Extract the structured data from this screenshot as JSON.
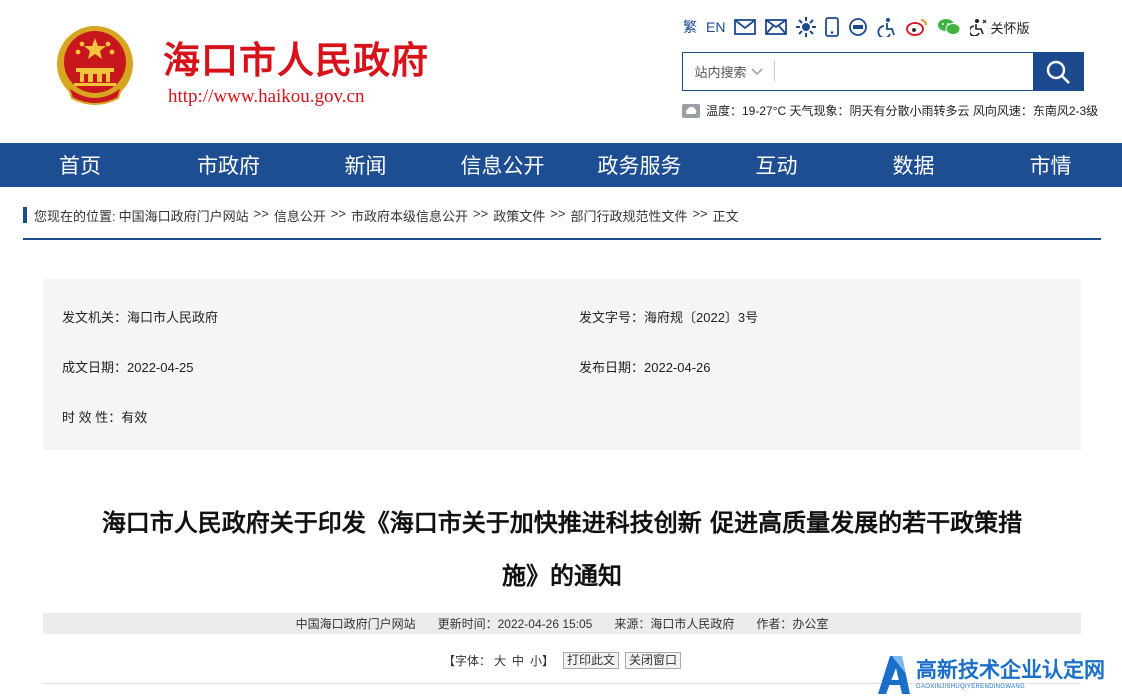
{
  "header": {
    "site_name": "海口市人民政府",
    "site_url": "http://www.haikou.gov.cn",
    "tools": {
      "traditional": "繁",
      "english": "EN",
      "care_mode": "关怀版"
    },
    "search": {
      "scope": "站内搜索",
      "placeholder": ""
    },
    "weather": {
      "text": "温度：19-27°C 天气现象：阴天有分散小雨转多云 风向风速：东南风2-3级"
    }
  },
  "nav": {
    "items": [
      "首页",
      "市政府",
      "新闻",
      "信息公开",
      "政务服务",
      "互动",
      "数据",
      "市情"
    ]
  },
  "breadcrumb": {
    "prefix": "您现在的位置:",
    "separator": ">>",
    "items": [
      "中国海口政府门户网站",
      "信息公开",
      "市政府本级信息公开",
      "政策文件",
      "部门行政规范性文件",
      "正文"
    ]
  },
  "meta": {
    "issuer_label": "发文机关：",
    "issuer": "海口市人民政府",
    "doc_no_label": "发文字号：",
    "doc_no": "海府规〔2022〕3号",
    "written_label": "成文日期：",
    "written": "2022-04-25",
    "published_label": "发布日期：",
    "published": "2022-04-26",
    "validity_label": "时 效 性：",
    "validity": "有效"
  },
  "article": {
    "title_line1": "海口市人民政府关于印发《海口市关于加快推进科技创新 促进高质量发展的若干政策措",
    "title_line2": "施》的通知",
    "site": "中国海口政府门户网站",
    "updated": "更新时间：2022-04-26 15:05",
    "source": "来源：海口市人民政府",
    "author": "作者：办公室",
    "font_label": "【字体：",
    "font_large": "大",
    "font_medium": "中",
    "font_small": "小】",
    "print_label": "打印此文",
    "close_label": "关闭窗口"
  },
  "watermark": {
    "title": "高新技术企业认定网",
    "sub": "GAOXINJISHUQIYERENDINGWANG"
  },
  "colors": {
    "brand_red": "#d8121b",
    "nav_blue": "#1d4e92",
    "watermark_blue": "#1a6fc9"
  }
}
